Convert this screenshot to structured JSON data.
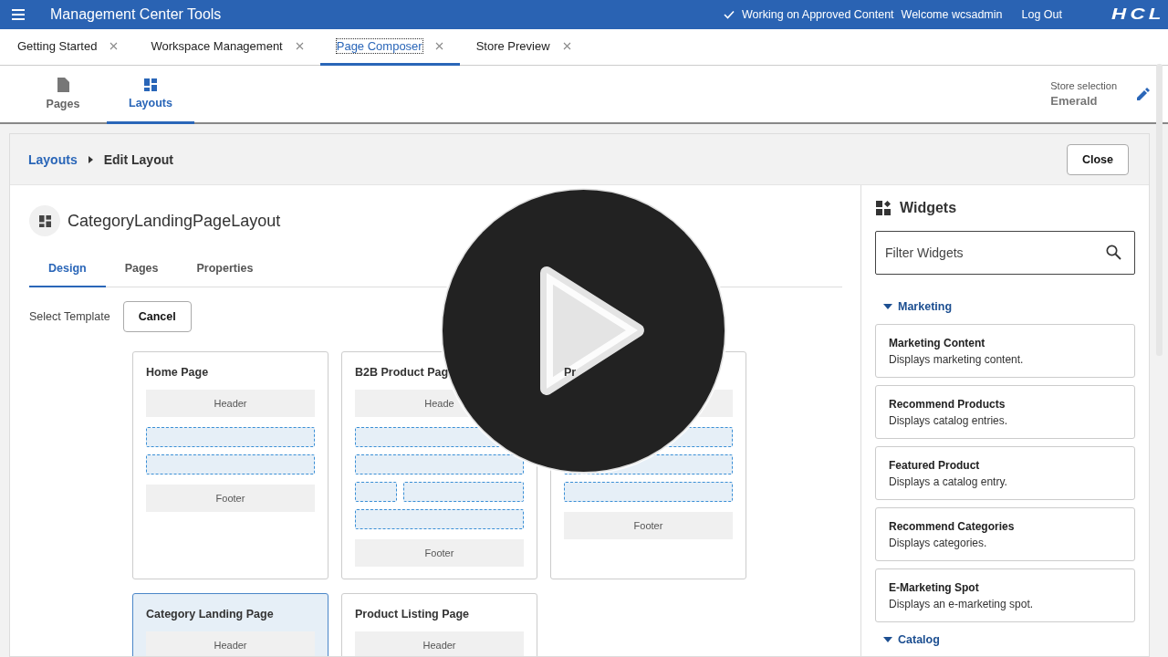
{
  "top_bar": {
    "title": "Management Center Tools",
    "status": "Working on Approved Content",
    "welcome": "Welcome wcsadmin",
    "logout": "Log Out",
    "logo": "HCL"
  },
  "tabs": [
    {
      "label": "Getting Started",
      "selected": false
    },
    {
      "label": "Workspace Management",
      "selected": false
    },
    {
      "label": "Page Composer",
      "selected": true
    },
    {
      "label": "Store Preview",
      "selected": false
    }
  ],
  "nav": [
    {
      "label": "Pages",
      "kind": "page",
      "selected": false
    },
    {
      "label": "Layouts",
      "kind": "layout",
      "selected": true
    }
  ],
  "store": {
    "label": "Store selection",
    "value": "Emerald"
  },
  "breadcrumb": {
    "parent": "Layouts",
    "current": "Edit Layout",
    "close": "Close"
  },
  "layout": {
    "title": "CategoryLandingPageLayout",
    "tabs": [
      {
        "label": "Design",
        "selected": true
      },
      {
        "label": "Pages",
        "selected": false
      },
      {
        "label": "Properties",
        "selected": false
      }
    ],
    "select_label": "Select Template",
    "cancel": "Cancel",
    "templates": [
      {
        "title": "Home Page",
        "selected": false,
        "zones": [
          {
            "kind": "header",
            "label": "Header"
          },
          {
            "kind": "slot"
          },
          {
            "kind": "slot"
          },
          {
            "kind": "footer",
            "label": "Footer"
          }
        ]
      },
      {
        "title": "B2B Product Pag",
        "selected": false,
        "zones": [
          {
            "kind": "header",
            "label": "Heade"
          },
          {
            "kind": "slot"
          },
          {
            "kind": "slot"
          },
          {
            "kind": "split"
          },
          {
            "kind": "slot"
          },
          {
            "kind": "footer",
            "label": "Footer"
          }
        ]
      },
      {
        "title": "Pr",
        "selected": false,
        "zones": [
          {
            "kind": "header"
          },
          {
            "kind": "slot"
          },
          {
            "kind": "slot"
          },
          {
            "kind": "slot"
          },
          {
            "kind": "footer",
            "label": "Footer"
          }
        ]
      },
      {
        "title": "Category Landing Page",
        "selected": true,
        "zones": [
          {
            "kind": "header",
            "label": "Header"
          }
        ]
      },
      {
        "title": "Product Listing Page",
        "selected": false,
        "zones": [
          {
            "kind": "header",
            "label": "Header"
          }
        ]
      }
    ]
  },
  "widgets": {
    "title": "Widgets",
    "filter": {
      "placeholder": "Filter Widgets"
    },
    "groups": [
      {
        "label": "Marketing",
        "expanded": true,
        "items": [
          {
            "title": "Marketing Content",
            "description": "Displays marketing content."
          },
          {
            "title": "Recommend Products",
            "description": "Displays catalog entries."
          },
          {
            "title": "Featured Product",
            "description": "Displays a catalog entry."
          },
          {
            "title": "Recommend Categories",
            "description": "Displays categories."
          },
          {
            "title": "E-Marketing Spot",
            "description": "Displays an e-marketing spot."
          }
        ]
      },
      {
        "label": "Catalog",
        "expanded": true
      }
    ]
  }
}
